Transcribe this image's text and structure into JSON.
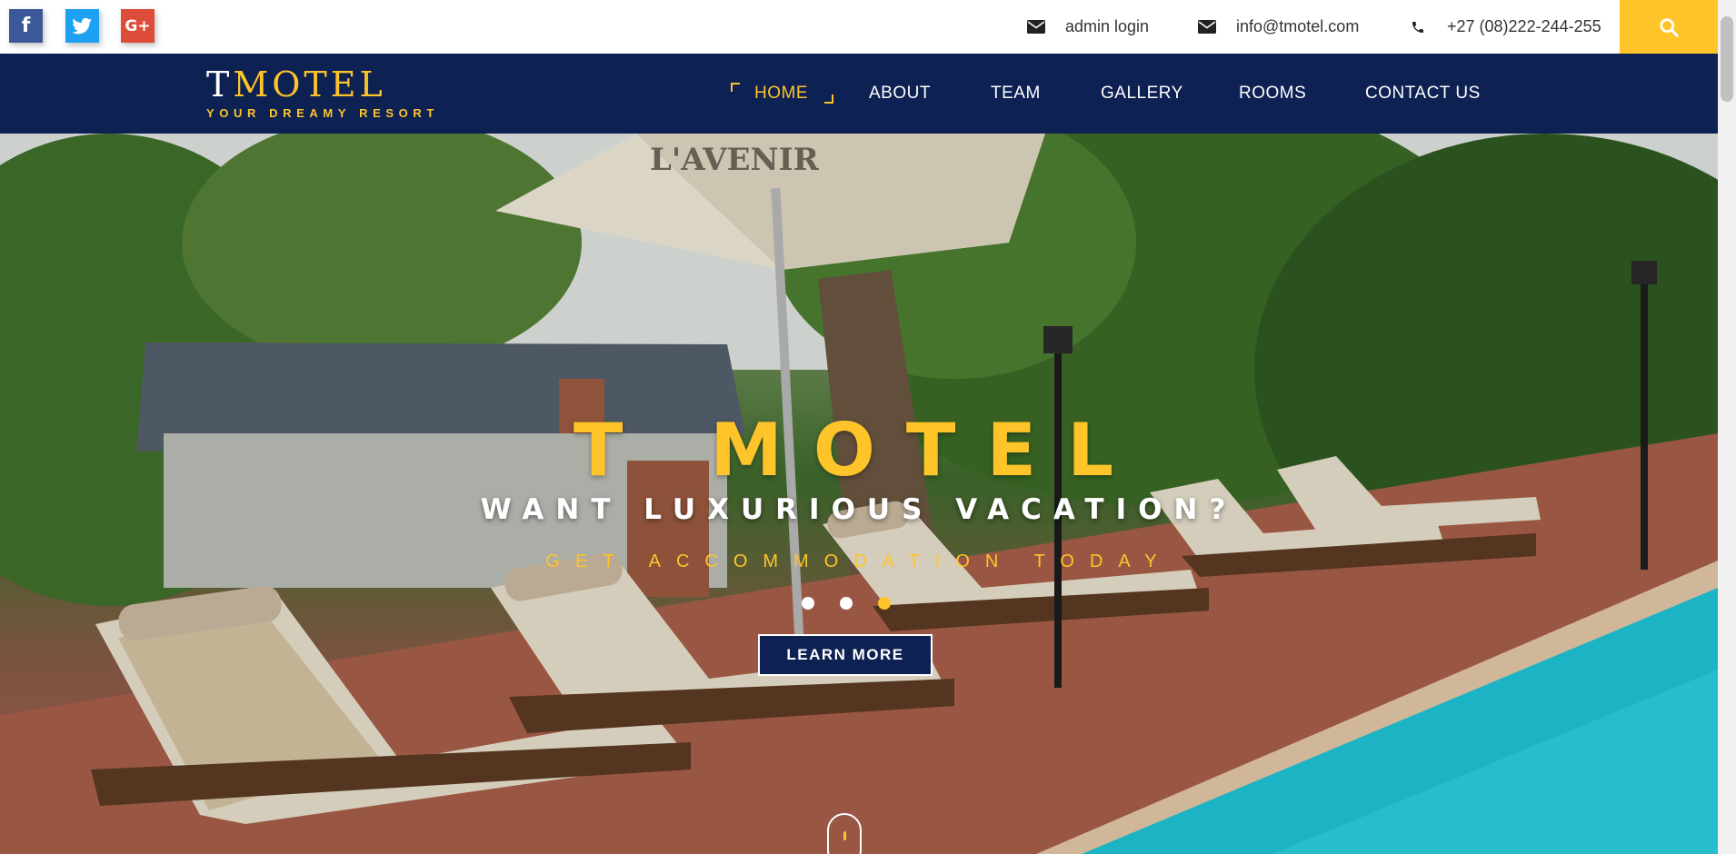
{
  "topbar": {
    "social": [
      {
        "name": "facebook",
        "glyph": "f"
      },
      {
        "name": "twitter",
        "glyph": "t"
      },
      {
        "name": "google-plus",
        "glyph": "G+"
      }
    ],
    "admin_login": "admin login",
    "email": "info@tmotel.com",
    "phone": "+27 (08)222-244-255"
  },
  "brand": {
    "logo_first": "T",
    "logo_rest": "MOTEL",
    "tagline": "YOUR DREAMY RESORT"
  },
  "nav": {
    "items": [
      {
        "label": "HOME",
        "active": true
      },
      {
        "label": "ABOUT",
        "active": false
      },
      {
        "label": "TEAM",
        "active": false
      },
      {
        "label": "GALLERY",
        "active": false
      },
      {
        "label": "ROOMS",
        "active": false
      },
      {
        "label": "CONTACT US",
        "active": false
      }
    ]
  },
  "hero": {
    "title": "T MOTEL",
    "subtitle": "WANT LUXURIOUS VACATION?",
    "tagline": "GET ACCOMMODATION TODAY",
    "slide_count": 3,
    "active_slide": 3,
    "cta_label": "LEARN MORE",
    "umbrella_text": "L'AVENIR"
  },
  "colors": {
    "accent": "#fec42a",
    "navy": "#0d2152",
    "facebook": "#3b5998",
    "twitter": "#1da1f2",
    "google_plus": "#dd4b39",
    "pool": "#1fc4d6"
  },
  "icons": {
    "admin": "envelope-icon",
    "email": "envelope-icon",
    "phone": "phone-icon",
    "search": "search-icon",
    "scroll": "mouse-scroll-icon"
  }
}
